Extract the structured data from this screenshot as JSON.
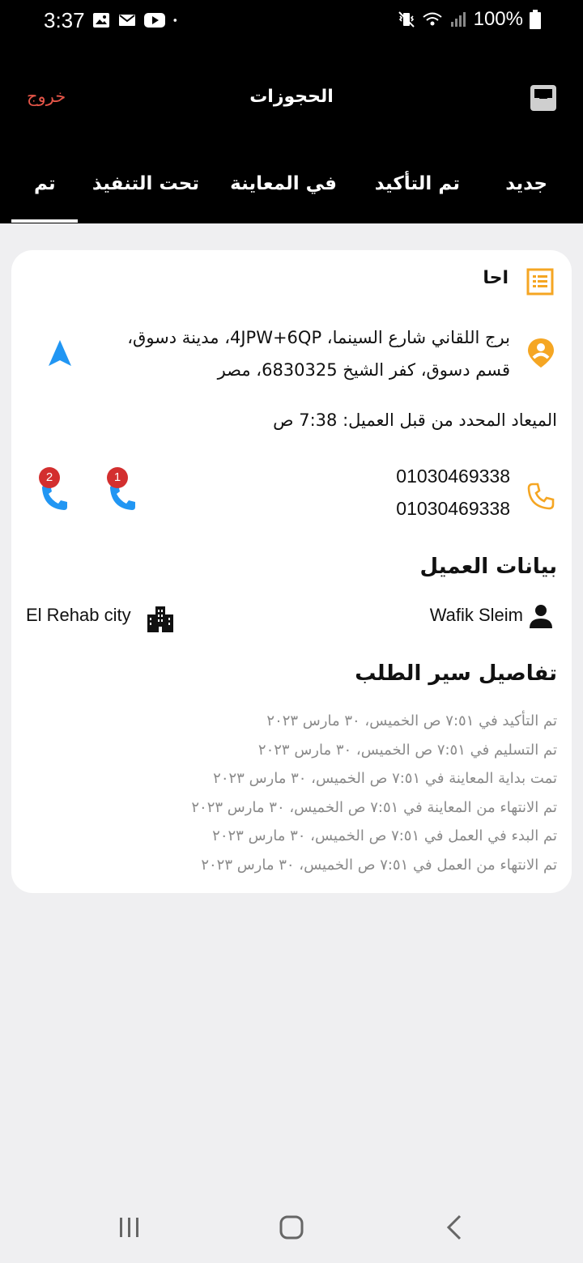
{
  "status_bar": {
    "time": "3:37",
    "battery": "100%",
    "left_icons": [
      "gallery-icon",
      "email-icon",
      "youtube-icon",
      "dot-icon"
    ],
    "right_icons": [
      "vibrate-icon",
      "wifi-icon",
      "signal-icon",
      "battery-icon"
    ]
  },
  "app_bar": {
    "title": "الحجوزات",
    "logout_label": "خروج",
    "inbox_icon": "inbox-icon"
  },
  "tabs": [
    {
      "label": "جديد",
      "selected": false
    },
    {
      "label": "تم التأكيد",
      "selected": false
    },
    {
      "label": "في المعاينة",
      "selected": false
    },
    {
      "label": "تحت التنفيذ",
      "selected": false
    },
    {
      "label": "تم",
      "selected": true
    }
  ],
  "booking": {
    "title": "احا",
    "address": "برج اللقاني شارع السينما، 4JPW+6QP، مدينة دسوق، قسم دسوق، كفر الشيخ 6830325، مصر",
    "appointment": "الميعاد المحدد من قبل العميل: 7:38 ص",
    "phone_1": "01030469338",
    "phone_2": "01030469338",
    "call_buttons": [
      {
        "badge": "1"
      },
      {
        "badge": "2"
      }
    ],
    "customer_section_title": "بيانات العميل",
    "customer_name": "Wafik Sleim",
    "customer_city": "El Rehab city",
    "timeline_title": "تفاصيل سير الطلب",
    "timeline": [
      "تم التأكيد في  ٧:٥١ ص الخميس، ٣٠ مارس ٢٠٢٣",
      "تم التسليم في ٧:٥١ ص الخميس، ٣٠ مارس ٢٠٢٣",
      "تمت بداية المعاينة في ٧:٥١ ص الخميس، ٣٠ مارس ٢٠٢٣",
      "تم الانتهاء من المعاينة في ٧:٥١ ص الخميس، ٣٠ مارس ٢٠٢٣",
      "تم البدء في العمل في ٧:٥١ ص الخميس، ٣٠ مارس ٢٠٢٣",
      "تم الانتهاء من العمل في ٧:٥١ ص الخميس، ٣٠ مارس ٢٠٢٣"
    ]
  },
  "colors": {
    "accent_orange": "#f5a623",
    "nav_blue": "#2196f3",
    "logout_red": "#e55548",
    "badge_red": "#d32f2f"
  }
}
